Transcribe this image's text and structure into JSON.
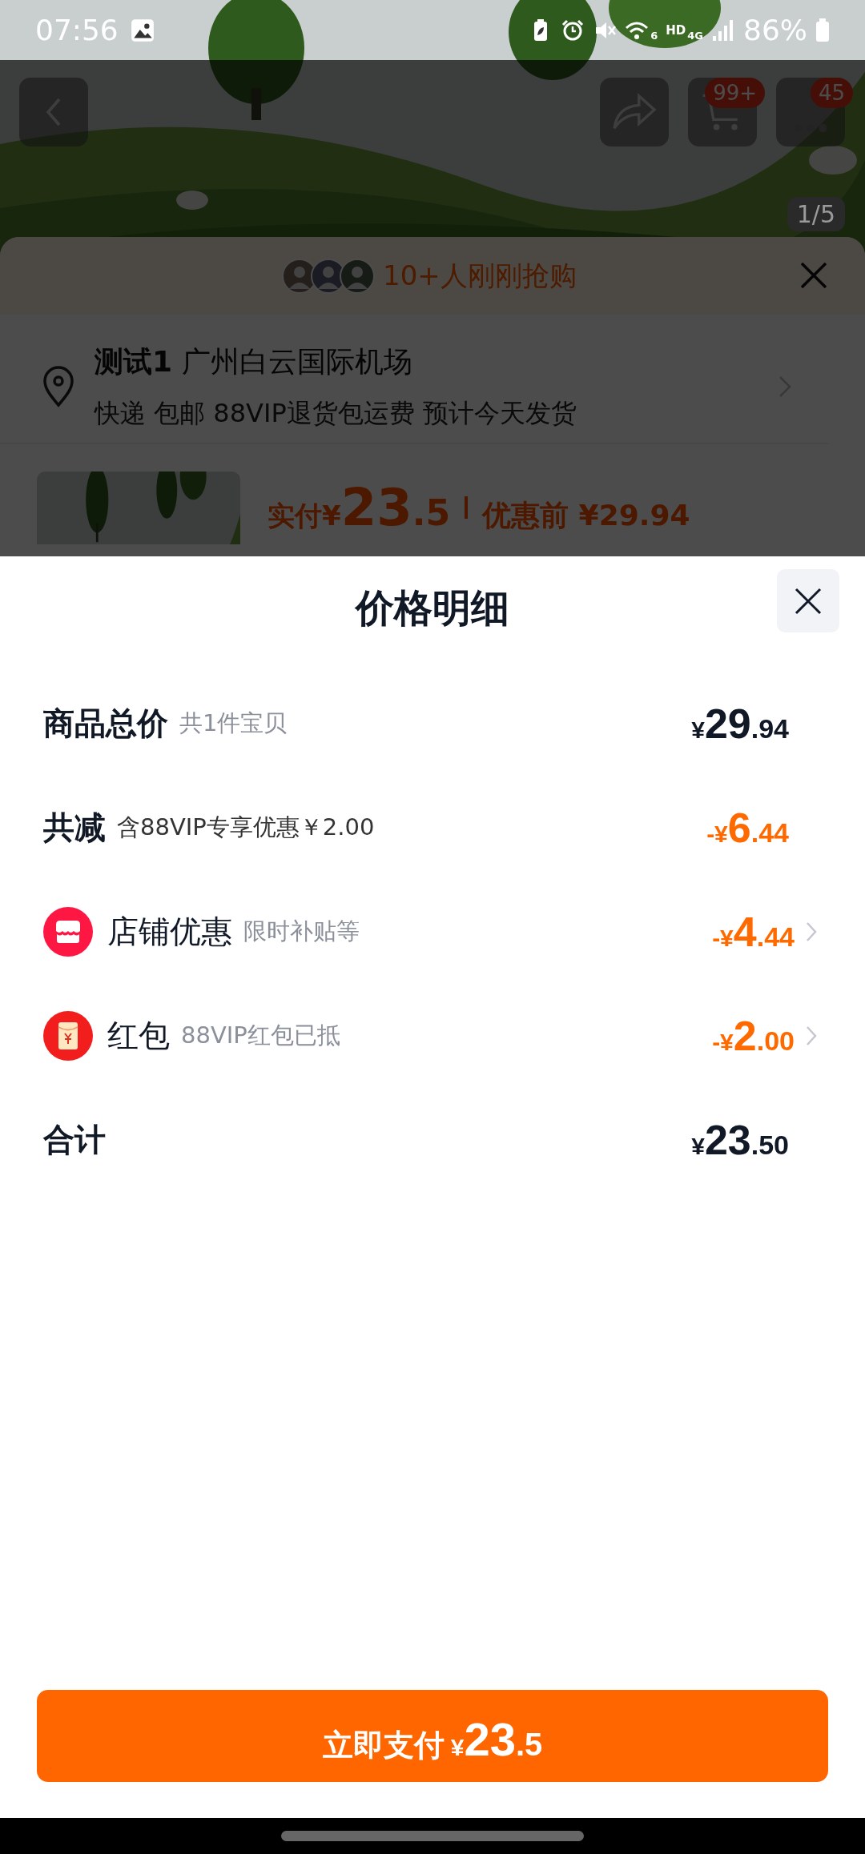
{
  "status_bar": {
    "time": "07:56",
    "wifi_label": "6",
    "hd_label": "HD",
    "network": "4G",
    "battery": "86%"
  },
  "product_header": {
    "cart_badge": "99+",
    "message_badge": "45",
    "image_counter": "1/5"
  },
  "order_sheet": {
    "buyers_note": "10+人刚刚抢购",
    "address": "**测试1** 广州白云国际机场",
    "shipping": "快递 包邮 88VIP退货包运费 预计今天发货",
    "paid_label": "实付",
    "paid_currency": "¥",
    "paid_integer": "23",
    "paid_decimal": ".5",
    "before_label": "优惠前",
    "before_price": "¥29.94"
  },
  "price_detail": {
    "title": "价格明细",
    "rows": [
      {
        "kind": "subtotal",
        "label": "商品总价",
        "note": "共1件宝贝",
        "currency": "¥",
        "integer": "29",
        "decimal": ".94"
      },
      {
        "kind": "reduction",
        "label": "共减",
        "note": "含88VIP专享优惠￥2.00",
        "currency": "-¥",
        "integer": "6",
        "decimal": ".44"
      },
      {
        "kind": "store_discount",
        "label": "店铺优惠",
        "note": "限时补贴等",
        "currency": "-¥",
        "integer": "4",
        "decimal": ".44"
      },
      {
        "kind": "red_packet",
        "label": "红包",
        "note": "88VIP红包已抵",
        "currency": "-¥",
        "integer": "2",
        "decimal": ".00"
      },
      {
        "kind": "total",
        "label": "合计",
        "currency": "¥",
        "integer": "23",
        "decimal": ".50"
      }
    ]
  },
  "pay_button": {
    "label": "立即支付",
    "currency": "¥",
    "integer": "23",
    "decimal": ".5"
  }
}
